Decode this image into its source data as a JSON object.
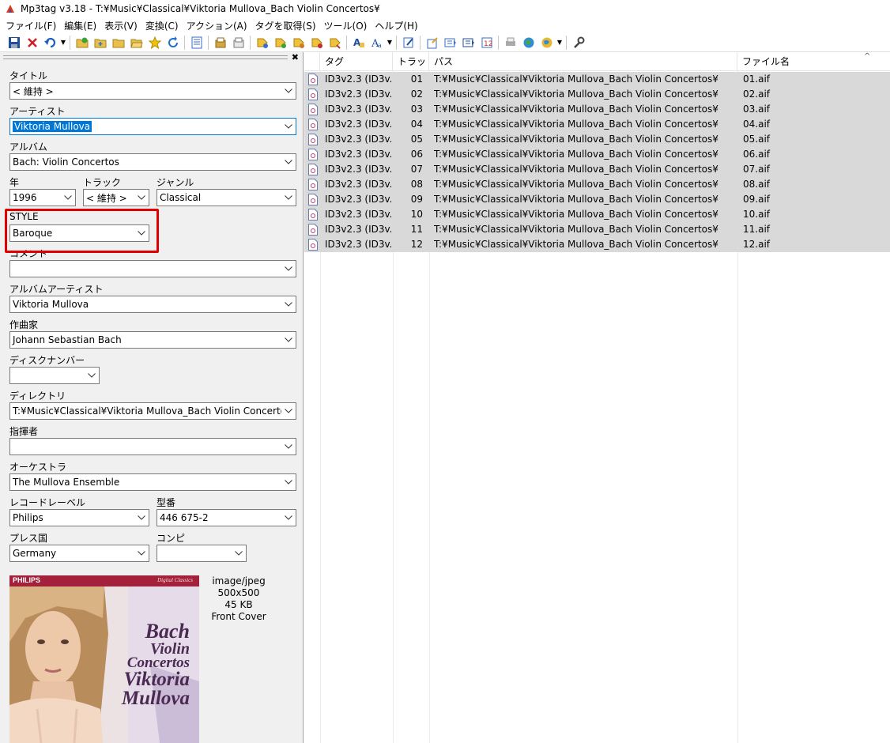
{
  "window": {
    "title": "Mp3tag v3.18  -  T:¥Music¥Classical¥Viktoria Mullova_Bach Violin Concertos¥"
  },
  "menu": [
    "ファイル(F)",
    "編集(E)",
    "表示(V)",
    "変換(C)",
    "アクション(A)",
    "タグを取得(S)",
    "ツール(O)",
    "ヘルプ(H)"
  ],
  "editor": {
    "title_label": "タイトル",
    "title_value": "< 維持 >",
    "artist_label": "アーティスト",
    "artist_value": "Viktoria Mullova",
    "album_label": "アルバム",
    "album_value": "Bach: Violin Concertos",
    "year_label": "年",
    "year_value": "1996",
    "track_label": "トラック",
    "track_value": "< 維持 >",
    "genre_label": "ジャンル",
    "genre_value": "Classical",
    "style_label": "STYLE",
    "style_value": "Baroque",
    "comment_label": "コメント",
    "comment_value": "",
    "albumartist_label": "アルバムアーティスト",
    "albumartist_value": "Viktoria Mullova",
    "composer_label": "作曲家",
    "composer_value": "Johann Sebastian Bach",
    "discnumber_label": "ディスクナンバー",
    "discnumber_value": "",
    "directory_label": "ディレクトリ",
    "directory_value": "T:¥Music¥Classical¥Viktoria Mullova_Bach Violin Concertos¥",
    "conductor_label": "指揮者",
    "conductor_value": "",
    "orchestra_label": "オーケストラ",
    "orchestra_value": "The Mullova Ensemble",
    "label_label": "レコードレーベル",
    "label_value": "Philips",
    "catalog_label": "型番",
    "catalog_value": "446 675-2",
    "country_label": "プレス国",
    "country_value": "Germany",
    "compilation_label": "コンピ",
    "compilation_value": ""
  },
  "cover": {
    "brand": "PHILIPS",
    "series": "Digital Classics",
    "line1": "Bach",
    "line2": "Violin",
    "line3": "Concertos",
    "line4": "Viktoria",
    "line5": "Mullova",
    "info": [
      "image/jpeg",
      "500x500",
      "45 KB",
      "Front Cover"
    ]
  },
  "list": {
    "headers": [
      "タグ",
      "トラック",
      "パス",
      "ファイル名"
    ],
    "rows": [
      {
        "tag": "ID3v2.3 (ID3v...",
        "track": "01",
        "path": "T:¥Music¥Classical¥Viktoria Mullova_Bach Violin Concertos¥",
        "file": "01.aif"
      },
      {
        "tag": "ID3v2.3 (ID3v...",
        "track": "02",
        "path": "T:¥Music¥Classical¥Viktoria Mullova_Bach Violin Concertos¥",
        "file": "02.aif"
      },
      {
        "tag": "ID3v2.3 (ID3v...",
        "track": "03",
        "path": "T:¥Music¥Classical¥Viktoria Mullova_Bach Violin Concertos¥",
        "file": "03.aif"
      },
      {
        "tag": "ID3v2.3 (ID3v...",
        "track": "04",
        "path": "T:¥Music¥Classical¥Viktoria Mullova_Bach Violin Concertos¥",
        "file": "04.aif"
      },
      {
        "tag": "ID3v2.3 (ID3v...",
        "track": "05",
        "path": "T:¥Music¥Classical¥Viktoria Mullova_Bach Violin Concertos¥",
        "file": "05.aif"
      },
      {
        "tag": "ID3v2.3 (ID3v...",
        "track": "06",
        "path": "T:¥Music¥Classical¥Viktoria Mullova_Bach Violin Concertos¥",
        "file": "06.aif"
      },
      {
        "tag": "ID3v2.3 (ID3v...",
        "track": "07",
        "path": "T:¥Music¥Classical¥Viktoria Mullova_Bach Violin Concertos¥",
        "file": "07.aif"
      },
      {
        "tag": "ID3v2.3 (ID3v...",
        "track": "08",
        "path": "T:¥Music¥Classical¥Viktoria Mullova_Bach Violin Concertos¥",
        "file": "08.aif"
      },
      {
        "tag": "ID3v2.3 (ID3v...",
        "track": "09",
        "path": "T:¥Music¥Classical¥Viktoria Mullova_Bach Violin Concertos¥",
        "file": "09.aif"
      },
      {
        "tag": "ID3v2.3 (ID3v...",
        "track": "10",
        "path": "T:¥Music¥Classical¥Viktoria Mullova_Bach Violin Concertos¥",
        "file": "10.aif"
      },
      {
        "tag": "ID3v2.3 (ID3v...",
        "track": "11",
        "path": "T:¥Music¥Classical¥Viktoria Mullova_Bach Violin Concertos¥",
        "file": "11.aif"
      },
      {
        "tag": "ID3v2.3 (ID3v...",
        "track": "12",
        "path": "T:¥Music¥Classical¥Viktoria Mullova_Bach Violin Concertos¥",
        "file": "12.aif"
      }
    ]
  },
  "colors": {
    "highlight": "#e00000",
    "selection": "#0078d7",
    "row_selected": "#d9d9d9"
  }
}
